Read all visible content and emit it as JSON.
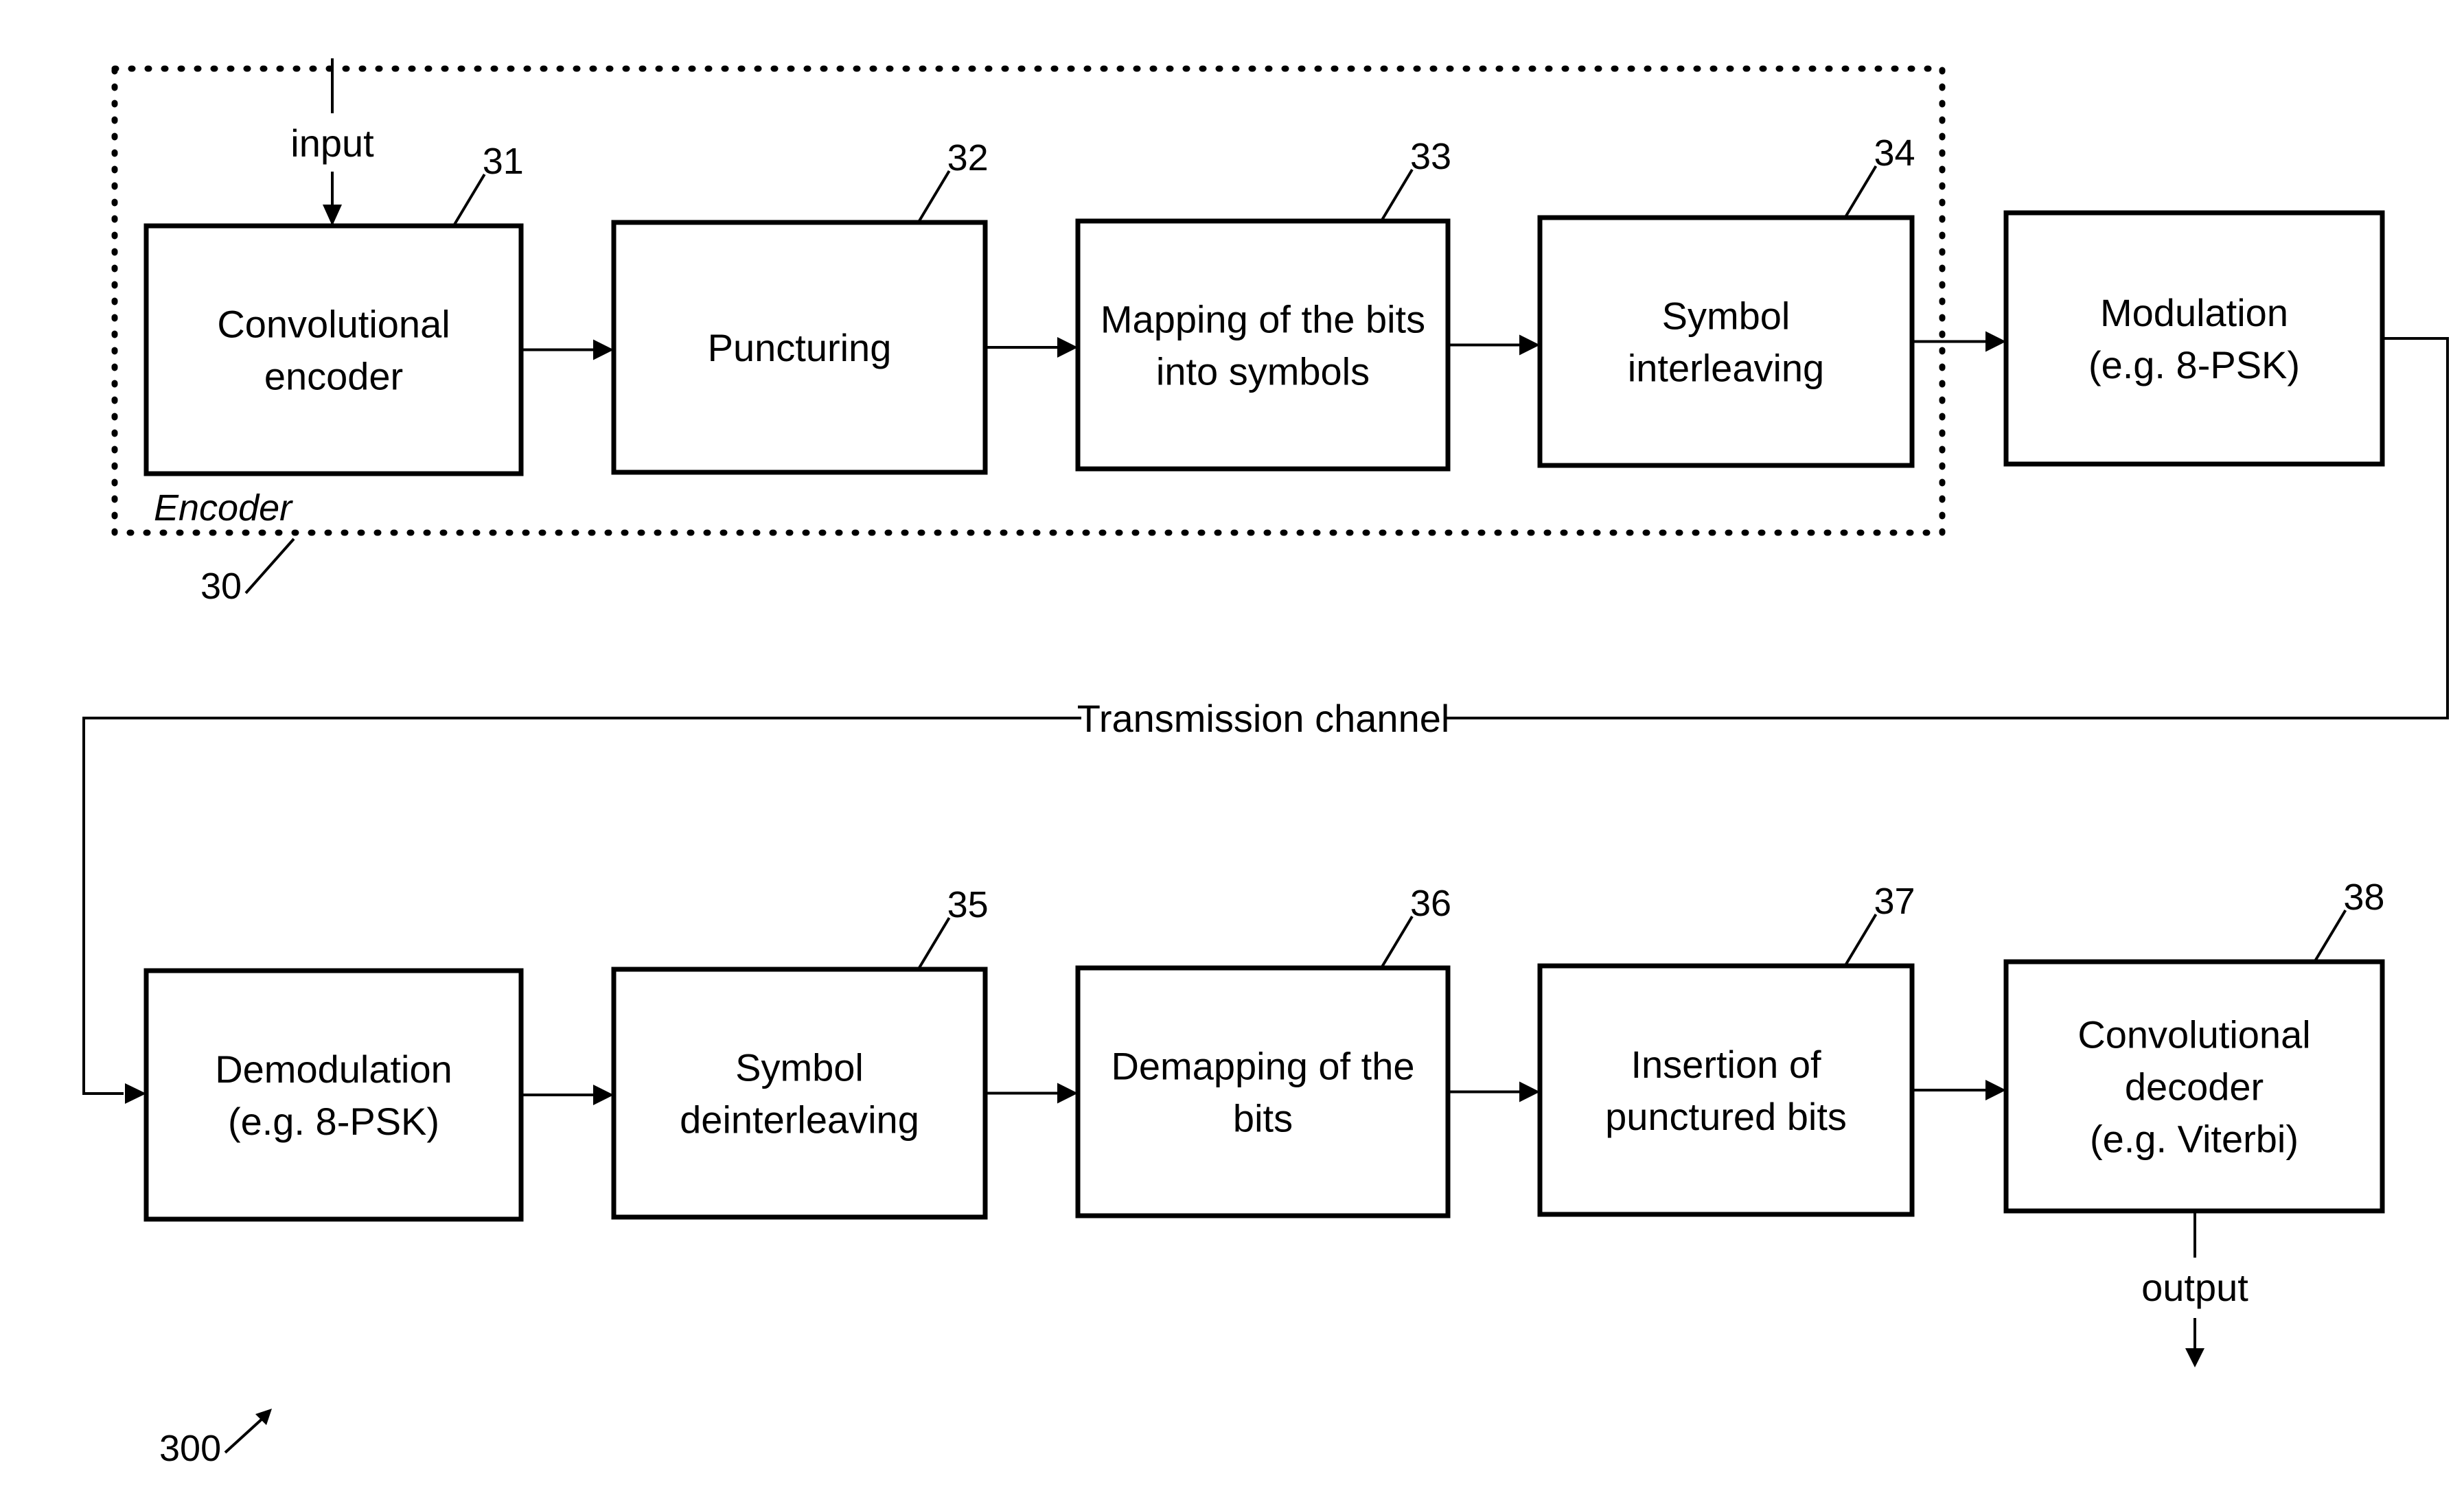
{
  "figure": {
    "reference": "300",
    "encoder_group": {
      "label": "Encoder",
      "reference": "30"
    },
    "input_label": "input",
    "output_label": "output",
    "channel_label": "Transmission channel",
    "blocks": [
      {
        "id": "31",
        "lines": [
          "Convolutional",
          "encoder"
        ]
      },
      {
        "id": "32",
        "lines": [
          "Puncturing"
        ]
      },
      {
        "id": "33",
        "lines": [
          "Mapping of the bits",
          "into symbols"
        ]
      },
      {
        "id": "34",
        "lines": [
          "Symbol",
          "interleaving"
        ]
      },
      {
        "id": "",
        "lines": [
          "Modulation",
          "(e.g. 8-PSK)"
        ]
      },
      {
        "id": "",
        "lines": [
          "Demodulation",
          "(e.g. 8-PSK)"
        ]
      },
      {
        "id": "35",
        "lines": [
          "Symbol",
          "deinterleaving"
        ]
      },
      {
        "id": "36",
        "lines": [
          "Demapping of the",
          "bits"
        ]
      },
      {
        "id": "37",
        "lines": [
          "Insertion of",
          "punctured bits"
        ]
      },
      {
        "id": "38",
        "lines": [
          "Convolutional",
          "decoder",
          "(e.g. Viterbi)"
        ]
      }
    ]
  }
}
